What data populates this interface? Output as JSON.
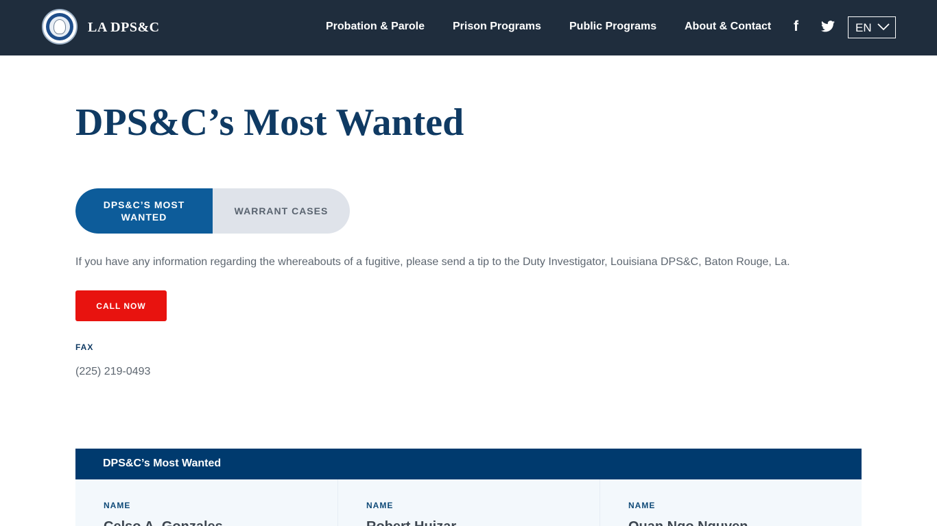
{
  "header": {
    "brand": "LA DPS&C",
    "nav": [
      "Probation & Parole",
      "Prison Programs",
      "Public Programs",
      "About & Contact"
    ],
    "social": {
      "facebook": "f"
    },
    "language": "EN"
  },
  "page": {
    "title": "DPS&C’s Most Wanted",
    "tabs": [
      {
        "label": "DPS&C’S MOST WANTED",
        "active": true
      },
      {
        "label": "WARRANT CASES",
        "active": false
      }
    ],
    "intro": "If you have any information regarding the whereabouts of a fugitive, please send a tip to the Duty Investigator, Louisiana DPS&C, Baton Rouge, La.",
    "call_button": "CALL NOW",
    "fax_label": "FAX",
    "fax_number": "(225) 219-0493"
  },
  "table": {
    "title": "DPS&C’s Most Wanted",
    "columns": [
      {
        "label": "NAME",
        "value": "Celso A. Gonzales"
      },
      {
        "label": "NAME",
        "value": "Robert Huizar"
      },
      {
        "label": "NAME",
        "value": "Quan Ngo Nguyen"
      }
    ]
  },
  "colors": {
    "topbar": "#1f2d3d",
    "title": "#0f3a63",
    "active_tab": "#0d5c9a",
    "call_button": "#e8130f",
    "table_header": "#003a6e"
  }
}
